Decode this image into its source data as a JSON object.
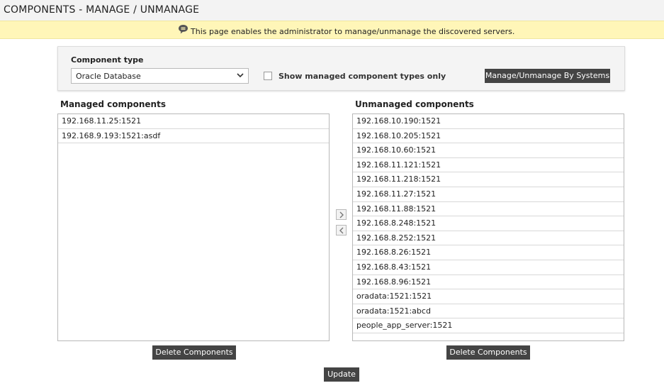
{
  "page": {
    "title": "COMPONENTS - MANAGE / UNMANAGE",
    "info_message": "This page enables the administrator to manage/unmanage the discovered servers.",
    "info_icon": "speech-bubble-icon"
  },
  "filter": {
    "component_type_label": "Component type",
    "component_type_value": "Oracle Database",
    "show_managed_only_label": "Show managed component types only",
    "show_managed_only_checked": false,
    "manage_by_systems_label": "Manage/Unmanage By Systems"
  },
  "managed": {
    "title": "Managed components",
    "items": [
      "192.168.11.25:1521",
      "192.168.9.193:1521:asdf"
    ],
    "delete_label": "Delete Components"
  },
  "unmanaged": {
    "title": "Unmanaged components",
    "items": [
      "192.168.10.190:1521",
      "192.168.10.205:1521",
      "192.168.10.60:1521",
      "192.168.11.121:1521",
      "192.168.11.218:1521",
      "192.168.11.27:1521",
      "192.168.11.88:1521",
      "192.168.8.248:1521",
      "192.168.8.252:1521",
      "192.168.8.26:1521",
      "192.168.8.43:1521",
      "192.168.8.96:1521",
      "oradata:1521:1521",
      "oradata:1521:abcd",
      "people_app_server:1521"
    ],
    "delete_label": "Delete Components"
  },
  "transfer": {
    "move_right_icon": "chevron-right-icon",
    "move_left_icon": "chevron-left-icon"
  },
  "update_label": "Update",
  "colors": {
    "info_bg": "#fff6b8",
    "button_bg": "#444444",
    "title_bg": "#f3f3f3"
  }
}
